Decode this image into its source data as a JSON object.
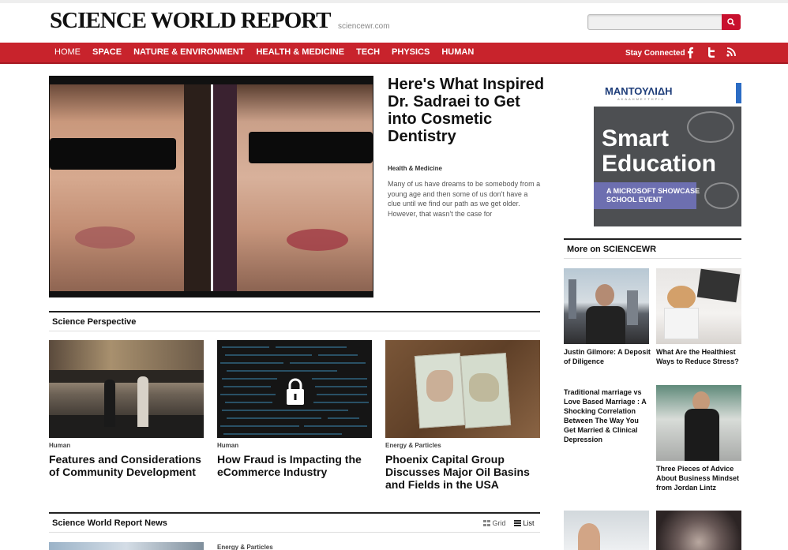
{
  "header": {
    "logo": "SCIENCE WORLD REPORT",
    "domain": "sciencewr.com",
    "search_placeholder": ""
  },
  "nav": {
    "items": [
      "HOME",
      "SPACE",
      "NATURE & ENVIRONMENT",
      "HEALTH & MEDICINE",
      "TECH",
      "PHYSICS",
      "HUMAN"
    ],
    "stay_connected": "Stay Connected",
    "social_icons": [
      "facebook-icon",
      "twitter-icon",
      "rss-icon"
    ]
  },
  "featured": {
    "title": "Here's What Inspired Dr. Sadraei to Get into Cosmetic Dentistry",
    "category": "Health & Medicine",
    "description": "Many of us have dreams to be somebody from a young age and then some of us don't have a clue until we find our path as we get older. However, that wasn't the case for"
  },
  "ad": {
    "brand": "ΜΑΝΤΟΥΛΙΔΗ",
    "brand_sub": "ΑΚΑΔΗΜΕΥΤΗΡΙΑ",
    "line1": "Smart",
    "line2": "Education",
    "band": "A MICROSOFT SHOWCASE SCHOOL EVENT"
  },
  "science_perspective": {
    "title": "Science Perspective",
    "cards": [
      {
        "category": "Human",
        "title": "Features and Considerations of Community Development"
      },
      {
        "category": "Human",
        "title": "How Fraud is Impacting the eCommerce Industry"
      },
      {
        "category": "Energy & Particles",
        "title": "Phoenix Capital Group Discusses Major Oil Basins and Fields in the USA"
      }
    ]
  },
  "news": {
    "title": "Science World Report News",
    "grid_label": "Grid",
    "list_label": "List",
    "first_category": "Energy & Particles"
  },
  "more": {
    "title": "More on SCIENCEWR",
    "items": [
      {
        "title": "Justin Gilmore: A Deposit of Diligence"
      },
      {
        "title": "What Are the Healthiest Ways to Reduce Stress?"
      },
      {
        "title": "Traditional marriage vs Love Based Marriage : A Shocking Correlation Between The Way You Get Married & Clinical Depression"
      },
      {
        "title": "Three Pieces of Advice About Business Mindset from Jordan Lintz"
      }
    ]
  },
  "colors": {
    "nav_red": "#c8232c",
    "search_red": "#c8102e",
    "ad_purple": "#6d6fb0"
  }
}
